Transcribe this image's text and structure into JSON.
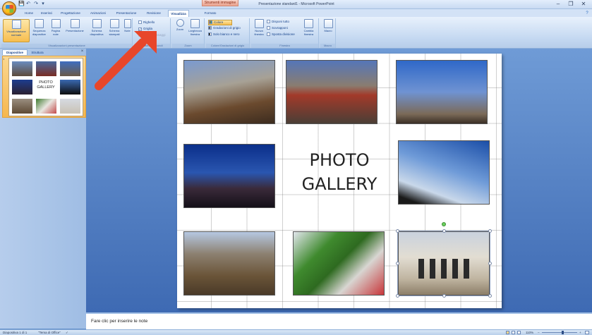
{
  "window": {
    "title": "Presentazione standard1 - Microsoft PowerPoint",
    "context_tab": "Strumenti immagine",
    "minimize": "–",
    "maximize": "❐",
    "close": "✕"
  },
  "qat": {
    "save": "💾",
    "undo": "↶",
    "redo": "↷",
    "customize": "▾"
  },
  "tabs": [
    "Home",
    "Inserisci",
    "Progettazione",
    "Animazioni",
    "Presentazione",
    "Revisione",
    "Visualizza",
    "Formato"
  ],
  "active_tab": "Visualizza",
  "ribbon": {
    "groups": {
      "views": {
        "label": "Visualizzazioni presentazione",
        "buttons": [
          "Visualizzazione normale",
          "Sequenza diapositive",
          "Pagina note",
          "Presentazione",
          "Schema diapositiva",
          "Schema stampati",
          "Note"
        ]
      },
      "showhide": {
        "label": "Mostra/Nascondi",
        "items": [
          "Righello",
          "Griglia",
          "Barra messaggi"
        ]
      },
      "zoom": {
        "label": "Zoom",
        "buttons": [
          "Zoom",
          "Larghezza finestra"
        ]
      },
      "color": {
        "label": "Colore/Gradazioni di grigio",
        "items": [
          "Colore",
          "Gradazioni di grigio",
          "Solo bianco e nero"
        ]
      },
      "window": {
        "label": "Finestra",
        "new_window": "Nuova finestra",
        "items": [
          "Disponi tutto",
          "Sovrapponi",
          "Sposta divisione"
        ],
        "switch_windows": "Cambia finestra"
      },
      "macro": {
        "label": "Macro",
        "button": "Macro"
      }
    }
  },
  "panel": {
    "tabs": [
      "Diapositive",
      "Struttura"
    ],
    "close": "×",
    "slide_number": "1"
  },
  "slide": {
    "title_line1": "PHOTO",
    "title_line2": "GALLERY"
  },
  "thumb": {
    "title": "PHOTO GALLERY"
  },
  "notes": {
    "placeholder": "Fare clic per inserire le note"
  },
  "status": {
    "slide_info": "Diapositiva 1 di 1",
    "theme": "\"Tema di Office\"",
    "zoom": "110%"
  },
  "colors": {
    "accent": "#f6b74f",
    "ribbon_text": "#15428b",
    "annotation_arrow": "#e8462a"
  }
}
